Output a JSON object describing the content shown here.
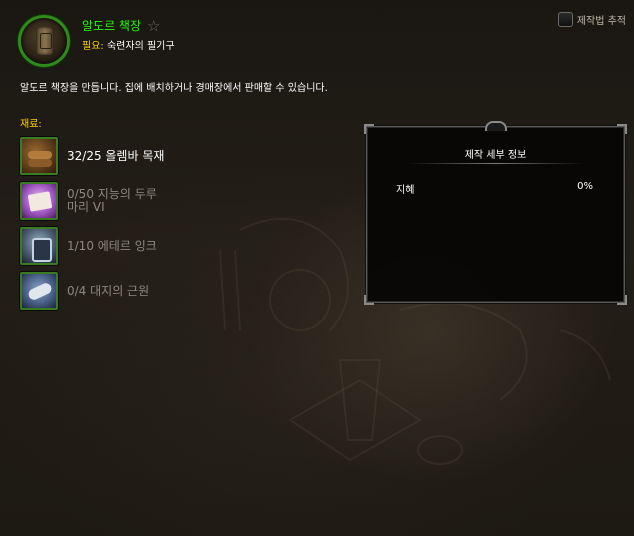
{
  "recipe": {
    "title": "알도르 책장",
    "icon": "bookshelf-icon",
    "requirement_label": "필요:",
    "requirement_value": "숙련자의 필기구",
    "description": "알도르 책장을 만듭니다. 집에 배치하거나 경매장에서 판매할 수 있습니다.",
    "title_color": "#1eff00"
  },
  "track": {
    "label": "제작법 추적",
    "checked": false
  },
  "reagents": {
    "label": "재료:",
    "items": [
      {
        "text": "32/25 올렘바 목재",
        "icon": "wood-logs-icon",
        "sufficient": true
      },
      {
        "text": "0/50 지능의 두루\n마리 VI",
        "icon": "scroll-icon",
        "sufficient": false
      },
      {
        "text": "1/10 에테르 잉크",
        "icon": "ink-icon",
        "sufficient": false
      },
      {
        "text": "0/4 대지의 근원",
        "icon": "canvas-bolt-icon",
        "sufficient": false
      }
    ]
  },
  "details": {
    "title": "제작 세부 정보",
    "stats": [
      {
        "name": "지혜",
        "value": "0%"
      }
    ]
  },
  "colors": {
    "label_gold": "#ffd200",
    "reagent_border": "#3b7c22",
    "insufficient_text": "#8c8880"
  }
}
